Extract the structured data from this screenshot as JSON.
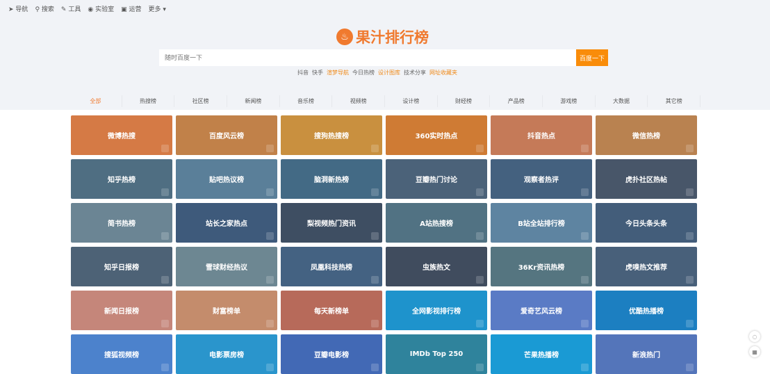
{
  "nav": [
    {
      "icon": "➤",
      "label": "导航"
    },
    {
      "icon": "⚲",
      "label": "搜索"
    },
    {
      "icon": "✎",
      "label": "工具"
    },
    {
      "icon": "◉",
      "label": "实验室"
    },
    {
      "icon": "▣",
      "label": "运营"
    },
    {
      "icon": "",
      "label": "更多 ▾"
    }
  ],
  "logo": {
    "icon": "♨",
    "title": "果汁排行榜"
  },
  "search": {
    "placeholder": "随时百度一下",
    "button": "百度一下"
  },
  "hot_links": [
    "抖音",
    "快手",
    "渲梦导航",
    "今日热榜",
    "设计图库",
    "技术分享",
    "网址收藏夹"
  ],
  "categories": [
    "全部",
    "热搜榜",
    "社区榜",
    "新闻榜",
    "音乐榜",
    "视频榜",
    "设计榜",
    "财经榜",
    "产品榜",
    "游戏榜",
    "大数据",
    "其它榜"
  ],
  "tiles": [
    {
      "label": "微博热搜",
      "color": "#d57a45"
    },
    {
      "label": "百度风云榜",
      "color": "#c18149"
    },
    {
      "label": "搜狗热搜榜",
      "color": "#c9903f"
    },
    {
      "label": "360实时热点",
      "color": "#cf7b34"
    },
    {
      "label": "抖音热点",
      "color": "#c57a58"
    },
    {
      "label": "微信热榜",
      "color": "#b98250"
    },
    {
      "label": "知乎热榜",
      "color": "#4f6e82"
    },
    {
      "label": "贴吧热议榜",
      "color": "#5a7f99"
    },
    {
      "label": "脑洞新热榜",
      "color": "#436a85"
    },
    {
      "label": "豆瓣热门讨论",
      "color": "#4b6279"
    },
    {
      "label": "观察者热评",
      "color": "#44617f"
    },
    {
      "label": "虎扑社区热帖",
      "color": "#485669"
    },
    {
      "label": "简书热榜",
      "color": "#6b8594"
    },
    {
      "label": "站长之家热点",
      "color": "#3e5a7b"
    },
    {
      "label": "梨视频热门资讯",
      "color": "#3e4e62"
    },
    {
      "label": "A站热搜榜",
      "color": "#517283"
    },
    {
      "label": "B站全站排行榜",
      "color": "#5e84a1"
    },
    {
      "label": "今日头条头条",
      "color": "#435d7a"
    },
    {
      "label": "知乎日报榜",
      "color": "#4d6276"
    },
    {
      "label": "雪球财经热议",
      "color": "#6d8792"
    },
    {
      "label": "凤凰科技热榜",
      "color": "#446282"
    },
    {
      "label": "虫族热文",
      "color": "#404c5e"
    },
    {
      "label": "36Kr资讯热榜",
      "color": "#557580"
    },
    {
      "label": "虎嗅热文推荐",
      "color": "#48607a"
    },
    {
      "label": "新闻日报榜",
      "color": "#c5867a"
    },
    {
      "label": "财富榜单",
      "color": "#c48c6c"
    },
    {
      "label": "每天新榜单",
      "color": "#b76a5a"
    },
    {
      "label": "全网影视排行榜",
      "color": "#1e93cc"
    },
    {
      "label": "爱奇艺风云榜",
      "color": "#5a7bc5"
    },
    {
      "label": "优酷热播榜",
      "color": "#1c7fc1"
    },
    {
      "label": "搜狐视频榜",
      "color": "#4c82cc"
    },
    {
      "label": "电影票房榜",
      "color": "#2a95cc"
    },
    {
      "label": "豆瓣电影榜",
      "color": "#4269b5"
    },
    {
      "label": "IMDb Top 250",
      "color": "#2f839c"
    },
    {
      "label": "芒果热播榜",
      "color": "#1a9ad4"
    },
    {
      "label": "新浪热门",
      "color": "#5475ba"
    }
  ],
  "side": {
    "chat": "◌",
    "qr": "▦"
  }
}
